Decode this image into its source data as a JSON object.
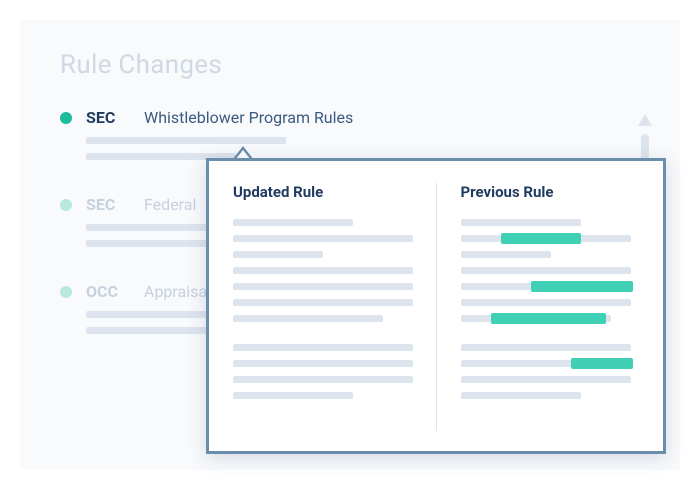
{
  "title": "Rule Changes",
  "rules": [
    {
      "agency": "SEC",
      "name": "Whistleblower Program Rules"
    },
    {
      "agency": "SEC",
      "name": "Federal"
    },
    {
      "agency": "OCC",
      "name": "Appraisa"
    }
  ],
  "popup": {
    "updated_label": "Updated Rule",
    "previous_label": "Previous Rule"
  }
}
